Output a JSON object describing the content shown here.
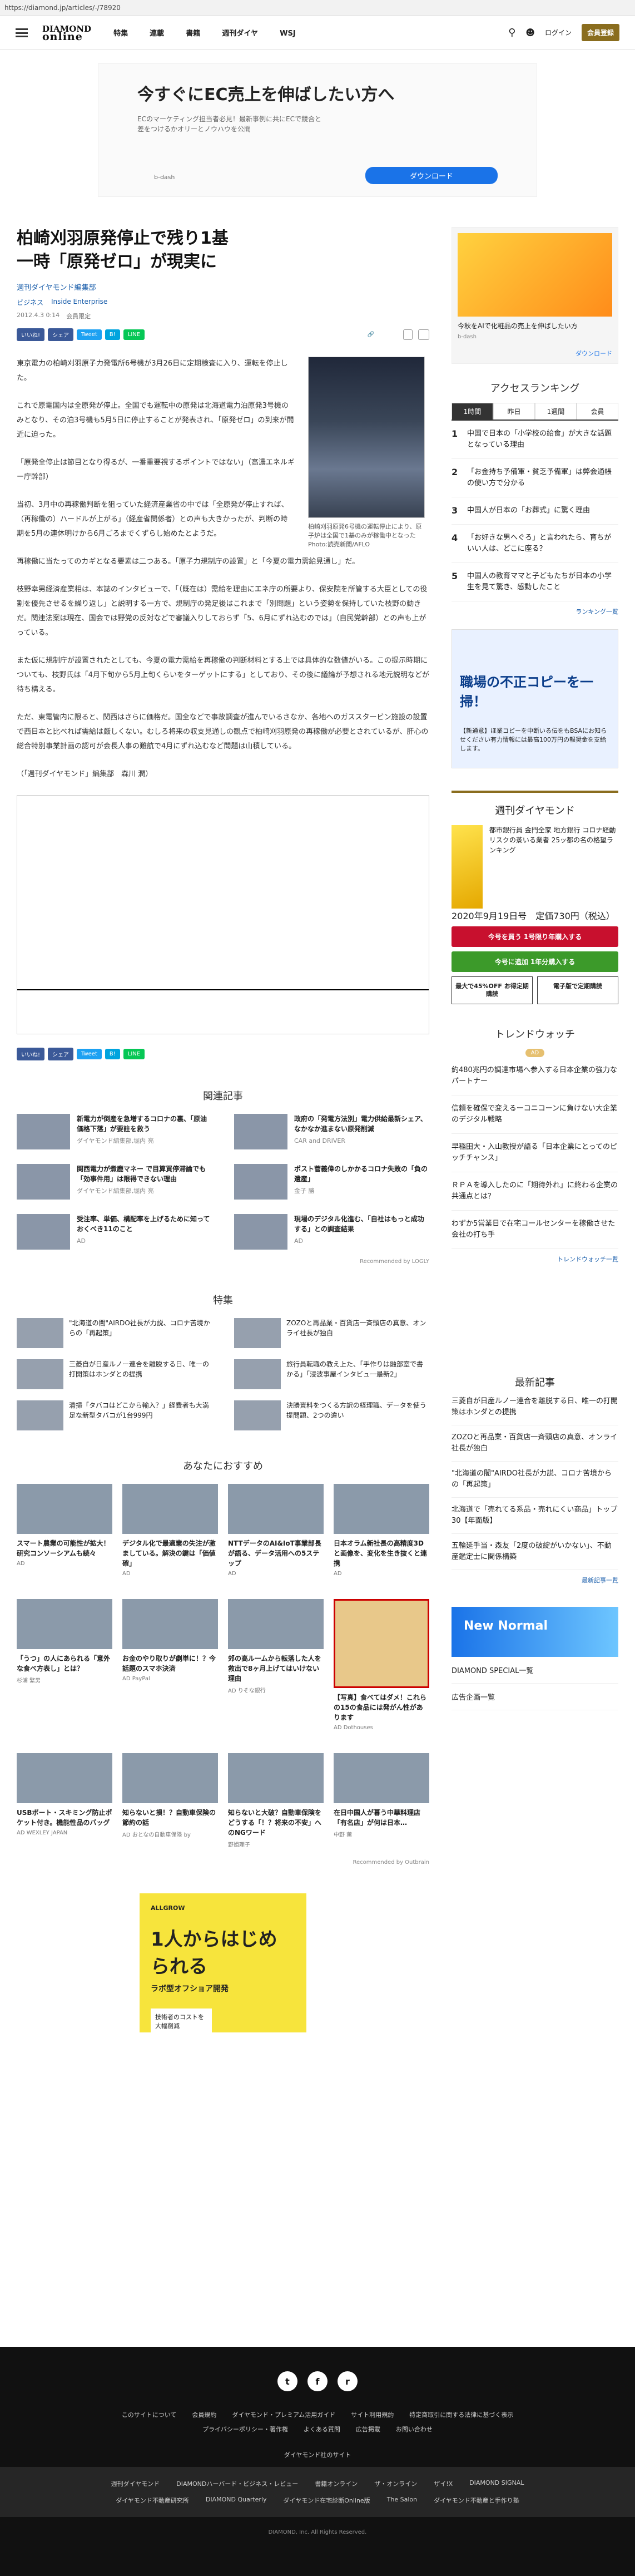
{
  "url": "https://diamond.jp/articles/-/78920",
  "header": {
    "logo_line1": "DIAMOND",
    "logo_line2": "online",
    "nav": [
      "特集",
      "連載",
      "書籍",
      "週刊ダイヤ",
      "WSJ"
    ],
    "login": "ログイン",
    "member": "会員登録"
  },
  "top_ad": {
    "title": "今すぐにEC売上を伸ばしたい方へ",
    "desc": "ECのマーケティング担当者必見！最新事例に共にECで競合と差をつけるかオリーとノウハウを公開",
    "source": "b-dash",
    "button": "ダウンロード"
  },
  "article": {
    "title_line1": "柏崎刈羽原発停止で残り1基",
    "title_line2": "一時「原発ゼロ」が現実に",
    "byline": "週刊ダイヤモンド編集部",
    "category": "ビジネス",
    "subcategory": "Inside Enterprise",
    "date": "2012.4.3 0:14",
    "member_only": "会員限定",
    "share": {
      "fb": "いいね!",
      "fb2": "シェア",
      "tw": "Tweet",
      "hb": "B!",
      "li": "LINE"
    },
    "font_small": "A",
    "font_large": "A",
    "para1": "東京電力の柏崎刈羽原子力発電所6号機が3月26日に定期検査に入り、運転を停止した。",
    "para2": "これで原電国内は全原発が停止。全国でも運転中の原発は北海道電力泊原発3号機のみとなり、その泊3号機も5月5日に停止することが発表され、「原発ゼロ」の到来が間近に迫った。",
    "para3": "「原発全停止は節目となり得るが、一番重要視するポイントではない」（高濃エネルギー庁幹部）",
    "para4": "当初、3月中の再稼働判断を狙っていた経済産業省の中では「全原発が停止すれば、（再稼働の）ハードルが上がる」（経産省関係者）との声も大きかったが、判断の時期を5月の連休明けから6月ごろまでくずらし始めたとようだ。",
    "photo_caption": "柏崎刈羽原発6号機の運転停止により、原子炉は全国で1基のみが稼働中となった Photo:読売新聞/AFLO",
    "para5": "再稼働に当たってのカギとなる要素は二つある。「原子力規制庁の設置」と「今夏の電力需給見通し」だ。",
    "para6": "枝野幸男経済産業相は、本誌のインタビューで、「（既在は）需給を理由にエネ庁の所要より、保安院を所管する大臣としての役割を優先させるを繰り返し」と説明する一方で、規制庁の発足後はこれまで「別問題」という姿勢を保持していた枝野の動きだ。関連法案は現在、国会では野党の反対などで審議入りしておらず「5、6月にずれ込むのでは」（自民党幹部）との声も上がっている。",
    "para7": "また仮に規制庁が設置されたとしても、今夏の電力需給を再稼働の判断材料とする上では具体的な数値がいる。この提示時期についても、枝野氏は「4月下旬から5月上旬くらいをターゲットにする」としており、その後に議論が予想される地元説明などが待ち構える。",
    "para8": "ただ、東電管内に限ると、関西はさらに価格だ。国全などで事故調査が進んでいるさなか、各地へのガススタービン施設の設置で西日本と比べれば需給は厳しくない。むしろ将来の収支見通しの観点で柏崎刈羽原発の再稼働が必要とされているが、肝心の総合特別事業計画の認可が会長人事の難航で4月にずれ込むなど問題は山積している。",
    "para9": "（「週刊ダイヤモンド」編集部　森川 潤）"
  },
  "related": {
    "title": "関連記事",
    "items": [
      {
        "title": "新電力が倒産を急増するコロナの裏、「原油価格下落」が要註を救う",
        "meta": "ダイヤモンド編集部,堀内 亮"
      },
      {
        "title": "政府の「発電方法別」電力供給最新シェア、なかなか進まない原発削減",
        "meta": "CAR and DRIVER"
      },
      {
        "title": "関西電力が煮鹿マネー で目算買停滞論でも「効事件用」は限得できない理由",
        "meta": "ダイヤモンド編集部,堀内 亮"
      },
      {
        "title": "ポスト菅義偉のしかかるコロナ失敗の「負の遺産」",
        "meta": "金子 勝"
      },
      {
        "title": "受注率、単価、構配率を上げるために知っておくべき11のこと",
        "meta": "AD"
      },
      {
        "title": "現場のデジタル化進む、「自社はもっと成功する」との調査結果",
        "meta": "AD"
      }
    ],
    "recommended_by": "Recommended by  LOGLY"
  },
  "tokushu": {
    "title": "特集",
    "items": [
      "\"北海道の闇\"AIRDO社長が力説、コロナ苦境からの「再起策」",
      "ZOZOと再品業・百貨店一斉頭店の真意、オンライ社長が独白",
      "三菱自が日産ルノー連合を離脱する日、唯一の打開策はホンダとの提携",
      "旅行員転職の教え上た、「手作りは融部室で書かる」「浸波事屋インタビュー最新2」",
      "清掃「タバコはどこから輸入？」経費者も大満足な新型タバコが1台999円",
      "決勝資料をつくる方訳の経理職、データを使う提問題、2つの違い"
    ]
  },
  "osusume": {
    "title": "あなたにおすすめ",
    "items": [
      {
        "title": "スマート農業の可能性が拡大！研究コンソーシアムも続々",
        "meta": "AD"
      },
      {
        "title": "デジタル化で最適業の失注が激ましている。解決の鍵は「価値確」",
        "meta": "AD"
      },
      {
        "title": "NTTデータのAI&IoT事業部長が語る、データ活用への5ステップ",
        "meta": "AD"
      },
      {
        "title": "日本オラム新社長の高精度3Dと画像を、変化を生き抜くと連携",
        "meta": "AD"
      },
      {
        "title": "「うつ」の人にあられる「意外な食べ方表し」とは？",
        "meta": "杉浦 繁男"
      },
      {
        "title": "お金のやり取りが劇単に！？今話題のスマホ決済",
        "meta": "AD PayPal"
      },
      {
        "title": "郊の高ルームから転落した人を救出で8ヶ月上げてはいけない理由",
        "meta": "AD りそな銀行"
      },
      {
        "title": "【写真】食べてはダメ！これらの15の食品には発がん性があります",
        "meta": "AD Dothouses"
      },
      {
        "title": "USBポート・スキミング防止ポケット付き。機能性品のバッグ",
        "meta": "AD WEXLEY JAPAN"
      },
      {
        "title": "知らないと損！？自動車保険の節約の話",
        "meta": "AD おとなの自動車保険 by"
      },
      {
        "title": "知らないと大破？自動車保険をどうする「！？将来の不安」へのNGワード",
        "meta": "野姐理子"
      },
      {
        "title": "在日中国人が暮う中華料理店「有名店」が何は日本…",
        "meta": "中野 薫"
      }
    ],
    "recommended_by": "Recommended by  Outbrain"
  },
  "bottom_ad": {
    "brand": "ALLGROW",
    "line1": "1人からはじめられる",
    "line2": "ラボ型オフショア開発",
    "line3": "技術者のコストを大幅削減"
  },
  "sidebar": {
    "ad1": {
      "title": "今秋をAIで化粧品の売上を伸ばしたい方",
      "source": "b-dash",
      "button": "ダウンロード"
    },
    "ranking_title": "アクセスランキング",
    "ranking_tabs": [
      "1時間",
      "昨日",
      "1週間",
      "会員"
    ],
    "ranking": [
      "中国で日本の「小学校の給食」が大きな話題となっている理由",
      "「お金持ち予備軍・貧乏予備軍」は弊会通帳の使い方で分かる",
      "中国人が日本の「お葬式」に驚く理由",
      "「お好きな男へぐろ」と言われたら、育ちがいい人は、どこに座る？",
      "中国人の教育ママと子どもたちが日本の小学生を見て驚き、感動したこと"
    ],
    "ranking_more": "ランキング一覧",
    "ad2": {
      "title": "職場の不正コピーを一掃！",
      "desc": "【新通意】ほ業コピーを中断いる伝をもBSAにお知らせください有力情報には最高100万円の報奨金を支給します。"
    },
    "weekly_title": "週刊ダイヤモンド",
    "weekly_desc": "都市銀行員 金門全家 地方銀行 コロナ経動リスクの蒸いる業者 25ッ都の名の格望ランキング",
    "weekly_issue": "2020年9月19日号　定価730円（税込）",
    "weekly_btn1": "今号を買う 1号限り年購入する",
    "weekly_btn2": "今号に追加 1年分購入する",
    "weekly_btn3": "最大で45%OFF お得定期購読",
    "weekly_btn4": "電子版で定期購読",
    "trend_title": "トレンドウォッチ",
    "trend_badge": "AD",
    "trend": [
      "約480兆円の調達市場へ参入する日本企業の強力なパートナー",
      "信頼を確保で変えるーコニコーンに負けない大企業のデジタル戦略",
      "早稲田大・入山教授が語る「日本企業にとってのピッチチャンス」",
      "ＲＰＡを導入したのに「期待外れ」に終わる企業の共通点とは？",
      "わずか5営業日で在宅コールセンターを稼働させた会社の打ち手"
    ],
    "trend_more": "トレンドウォッチ一覧",
    "new_title": "最新記事",
    "new_items": [
      "三菱自が日産ルノー連合を離脱する日、唯一の打開策はホンダとの提携",
      "ZOZOと再品業・百貨店一斉頭店の真意、オンライ社長が独白",
      "\"北海道の闇\"AIRDO社長が力説、コロナ苦境からの「再起策」",
      "北海道で「売れてる系品・売れにくい商品」トップ30【年面版】",
      "五輪延手当・森友「2度の破綻がいかない」、不動産鑑定士に関係構築"
    ],
    "new_more": "最新記事一覧",
    "ad3": "New Normal",
    "link1": "DIAMOND SPECIAL一覧",
    "link2": "広告企画一覧"
  },
  "footer": {
    "social": [
      "t",
      "f",
      "r"
    ],
    "links": [
      "このサイトについて",
      "会員規約",
      "ダイヤモンド・プレミアム活用ガイド",
      "サイト利用規約",
      "特定商取引に関する法律に基づく表示",
      "プライバシーポリシー・著作権",
      "よくある質問",
      "広告掲載",
      "お問い合わせ"
    ],
    "group_title": "ダイヤモンド社のサイト",
    "sites": [
      "週刊ダイヤモンド",
      "DIAMONDハーバード・ビジネス・レビュー",
      "書籍オンライン",
      "ザ・オンライン",
      "ザイ!X",
      "DIAMOND SIGNAL",
      "ダイヤモンド不動産研究所",
      "DIAMOND Quarterly",
      "ダイヤモンド在宅診断Online版",
      "The Salon",
      "ダイヤモンド不動産と手作り塾"
    ],
    "copyright": "DIAMOND, Inc. All Rights Reserved."
  }
}
